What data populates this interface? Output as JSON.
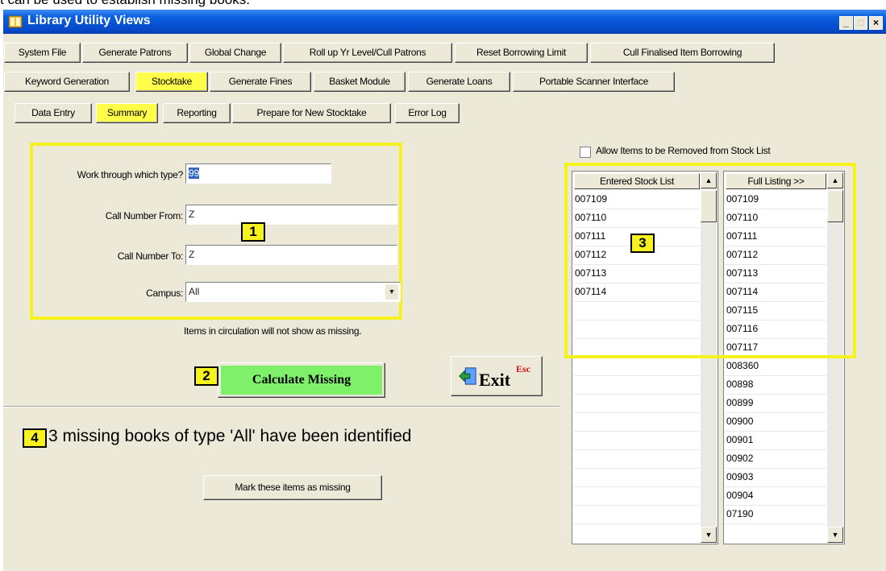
{
  "caption": "t can be used to establish missing books.",
  "window": {
    "title": "Library Utility Views",
    "min": "_",
    "max": "□",
    "close": "×"
  },
  "tabs_row1": [
    "System File",
    "Generate Patrons",
    "Global Change",
    "Roll up Yr Level/Cull Patrons",
    "Reset Borrowing Limit",
    "Cull Finalised Item Borrowing"
  ],
  "tabs_row2": [
    "Keyword Generation",
    "Stocktake",
    "Generate Fines",
    "Basket Module",
    "Generate Loans",
    "Portable Scanner Interface"
  ],
  "subtabs": [
    "Data Entry",
    "Summary",
    "Reporting",
    "Prepare for New Stocktake",
    "Error Log"
  ],
  "selected": {
    "tab": "Stocktake",
    "subtab": "Summary"
  },
  "form": {
    "type_label": "Work through which type?",
    "type_value": "99",
    "from_label": "Call Number From:",
    "from_value": "Z",
    "to_label": "Call Number To:",
    "to_value": "Z",
    "campus_label": "Campus:",
    "campus_value": "All"
  },
  "note": "Items in circulation will not show as missing.",
  "calc_button": "Calculate Missing",
  "exit_button": "Exit",
  "exit_sup": "Esc",
  "result": "3 missing books of type 'All' have been identified",
  "mark_button": "Mark these items as missing",
  "allow_checkbox": {
    "label": "Allow Items to be Removed from Stock List",
    "checked": false
  },
  "entered_list": {
    "header": "Entered Stock List",
    "items": [
      "007109",
      "007110",
      "007111",
      "007112",
      "007113",
      "007114"
    ]
  },
  "full_list": {
    "header": "Full Listing >>",
    "items": [
      "007109",
      "007110",
      "007111",
      "007112",
      "007113",
      "007114",
      "007115",
      "007116",
      "007117",
      "008360",
      "00898",
      "00899",
      "00900",
      "00901",
      "00902",
      "00903",
      "00904",
      "07190"
    ]
  },
  "badges": [
    "1",
    "2",
    "3",
    "4"
  ],
  "colors": {
    "highlight": "#f6f21e",
    "calc_button": "#7ef06a",
    "titlebar": "#0a5fe0"
  }
}
